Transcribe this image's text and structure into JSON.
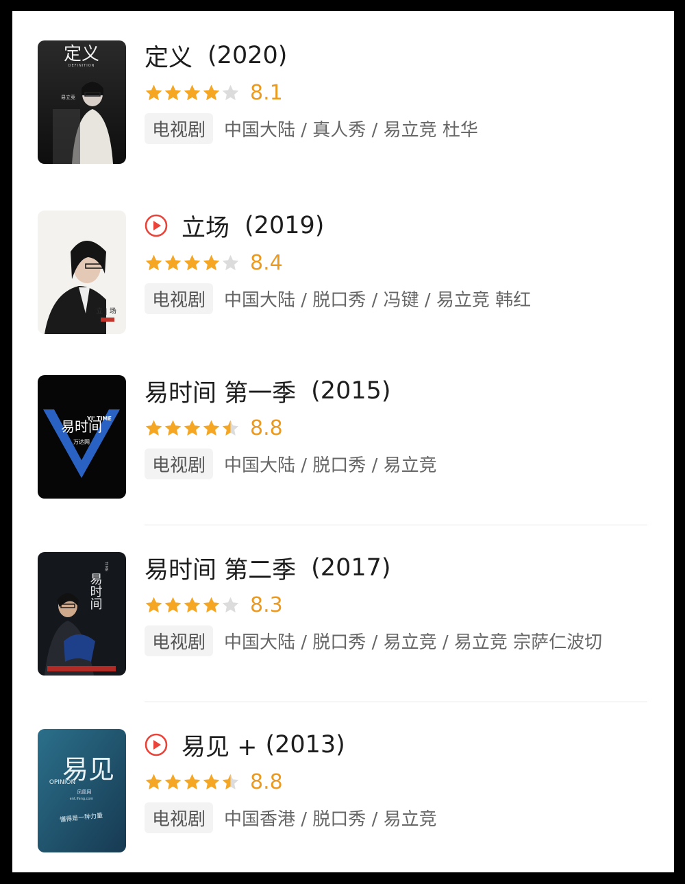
{
  "items": [
    {
      "title": "定义",
      "year": "(2020)",
      "has_play": false,
      "rating": 4,
      "score": "8.1",
      "tag": "电视剧",
      "info": "中国大陆 / 真人秀 / 易立竞 杜华",
      "poster": {
        "text": "定义",
        "sub": "DEFINITION",
        "name": "易立竞"
      }
    },
    {
      "title": "立场",
      "year": "(2019)",
      "has_play": true,
      "rating": 4,
      "score": "8.4",
      "tag": "电视剧",
      "info": "中国大陆 / 脱口秀 / 冯键 / 易立竞 韩红",
      "poster": {
        "text": "立 | 场"
      }
    },
    {
      "title": "易时间 第一季",
      "year": "(2015)",
      "has_play": false,
      "rating": 4.5,
      "score": "8.8",
      "tag": "电视剧",
      "info": "中国大陆 / 脱口秀 / 易立竞",
      "poster": {
        "text": "易时间",
        "sub": "YI' TIME",
        "brand": "万达网"
      }
    },
    {
      "title": "易时间 第二季",
      "year": "(2017)",
      "has_play": false,
      "rating": 4,
      "score": "8.3",
      "tag": "电视剧",
      "info": "中国大陆 / 脱口秀 / 易立竞 / 易立竞 宗萨仁波切",
      "poster": {
        "text": "易时间",
        "sub": "TIME"
      }
    },
    {
      "title": "易见 +",
      "year": "(2013)",
      "has_play": true,
      "rating": 4.5,
      "score": "8.8",
      "tag": "电视剧",
      "info": "中国香港 / 脱口秀 / 易立竞",
      "poster": {
        "text": "易见",
        "sub": "OPINION",
        "brand": "凤凰网",
        "url": "ent.ifeng.com",
        "slogan": "懂得是一种力量"
      }
    }
  ],
  "colors": {
    "star": "#f5a623",
    "star_empty": "#dcdcdc",
    "score": "#ec9a1f",
    "play": "#e8443a"
  },
  "icons": {
    "play": "play-circle-icon",
    "star": "star-icon"
  }
}
